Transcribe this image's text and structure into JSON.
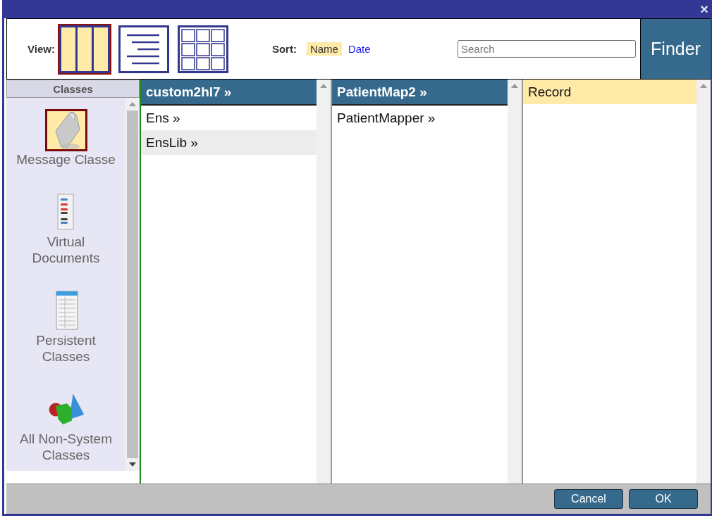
{
  "window": {
    "close": "×"
  },
  "toolbar": {
    "view_label": "View:",
    "views": [
      {
        "kind": "columns",
        "selected": true
      },
      {
        "kind": "list",
        "selected": false
      },
      {
        "kind": "grid",
        "selected": false
      }
    ],
    "sort_label": "Sort:",
    "sorts": [
      {
        "label": "Name",
        "selected": true
      },
      {
        "label": "Date",
        "selected": false
      }
    ],
    "search": {
      "placeholder": "Search"
    },
    "title": "Finder"
  },
  "sidebar": {
    "title": "Classes",
    "items": [
      {
        "kind": "message",
        "label": "Message Classe",
        "selected": true
      },
      {
        "kind": "virtual",
        "label": "Virtual Documents",
        "selected": false
      },
      {
        "kind": "persistent",
        "label": "Persistent Classes",
        "selected": false
      },
      {
        "kind": "all",
        "label": "All Non-System Classes",
        "selected": false
      }
    ]
  },
  "columns": [
    {
      "items": [
        {
          "label": "custom2hl7 »",
          "kind": "folder",
          "selected": true
        },
        {
          "label": "Ens »",
          "kind": "folder",
          "selected": false
        },
        {
          "label": "EnsLib »",
          "kind": "folder",
          "selected": false
        }
      ]
    },
    {
      "items": [
        {
          "label": "PatientMap2 »",
          "kind": "folder",
          "selected": true
        },
        {
          "label": "PatientMapper »",
          "kind": "folder",
          "selected": false
        }
      ]
    },
    {
      "items": [
        {
          "label": "Record",
          "kind": "leaf",
          "selected": true
        }
      ]
    }
  ],
  "buttons": [
    {
      "label": "Cancel"
    },
    {
      "label": "OK"
    }
  ]
}
